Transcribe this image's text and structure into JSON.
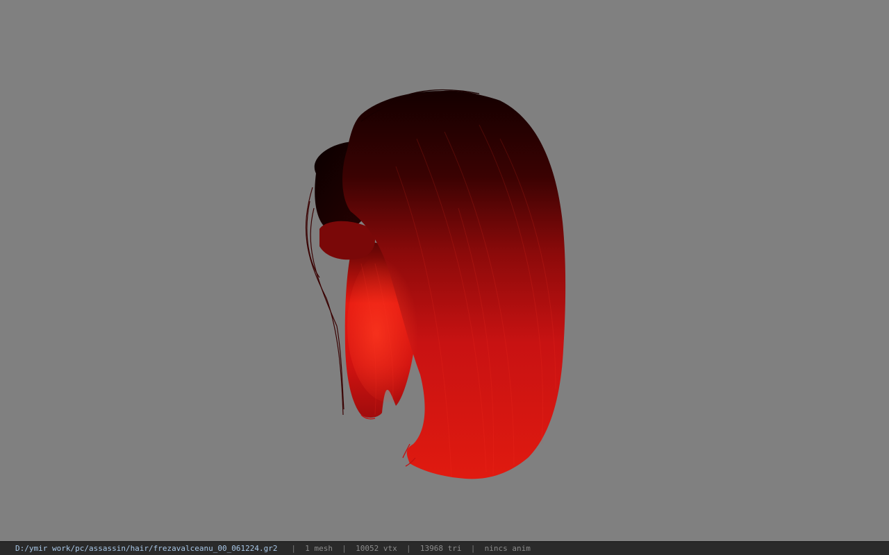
{
  "viewer": {
    "background_color": "#808080",
    "model_color": "#d01010",
    "model_icon": "hair-mesh"
  },
  "status_bar": {
    "file_path": "D:/ymir work/pc/assassin/hair/frezavalceanu_00_061224.gr2",
    "mesh_count": "1 mesh",
    "vertex_count": "10052 vtx",
    "triangle_count": "13968 tri",
    "animation": "nincs anim",
    "separator": "|"
  }
}
